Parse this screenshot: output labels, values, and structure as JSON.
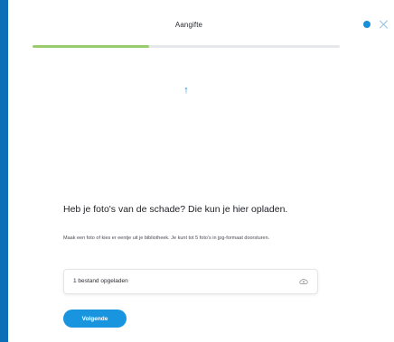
{
  "header": {
    "title": "Aangifte",
    "help_icon": "help-dot-icon",
    "close_icon": "close-icon"
  },
  "progress": {
    "fraction": 0.38,
    "fill_color": "#9acb6d",
    "track_color": "#e6e8eb"
  },
  "main": {
    "arrow_icon": "upload-arrow-icon",
    "question": "Heb je foto's van de schade? Die kun je hier opladen.",
    "description": "Maak een foto of kies er eentje uit je bibliotheek. Je kunt tot 5 foto's in jpg-formaat doorsturen.",
    "upload": {
      "label": "1 bestand opgeladen",
      "icon": "cloud-upload-icon"
    },
    "next_button": "Volgende"
  },
  "colors": {
    "accent": "#1895de",
    "frame": "#0a6fb6"
  }
}
